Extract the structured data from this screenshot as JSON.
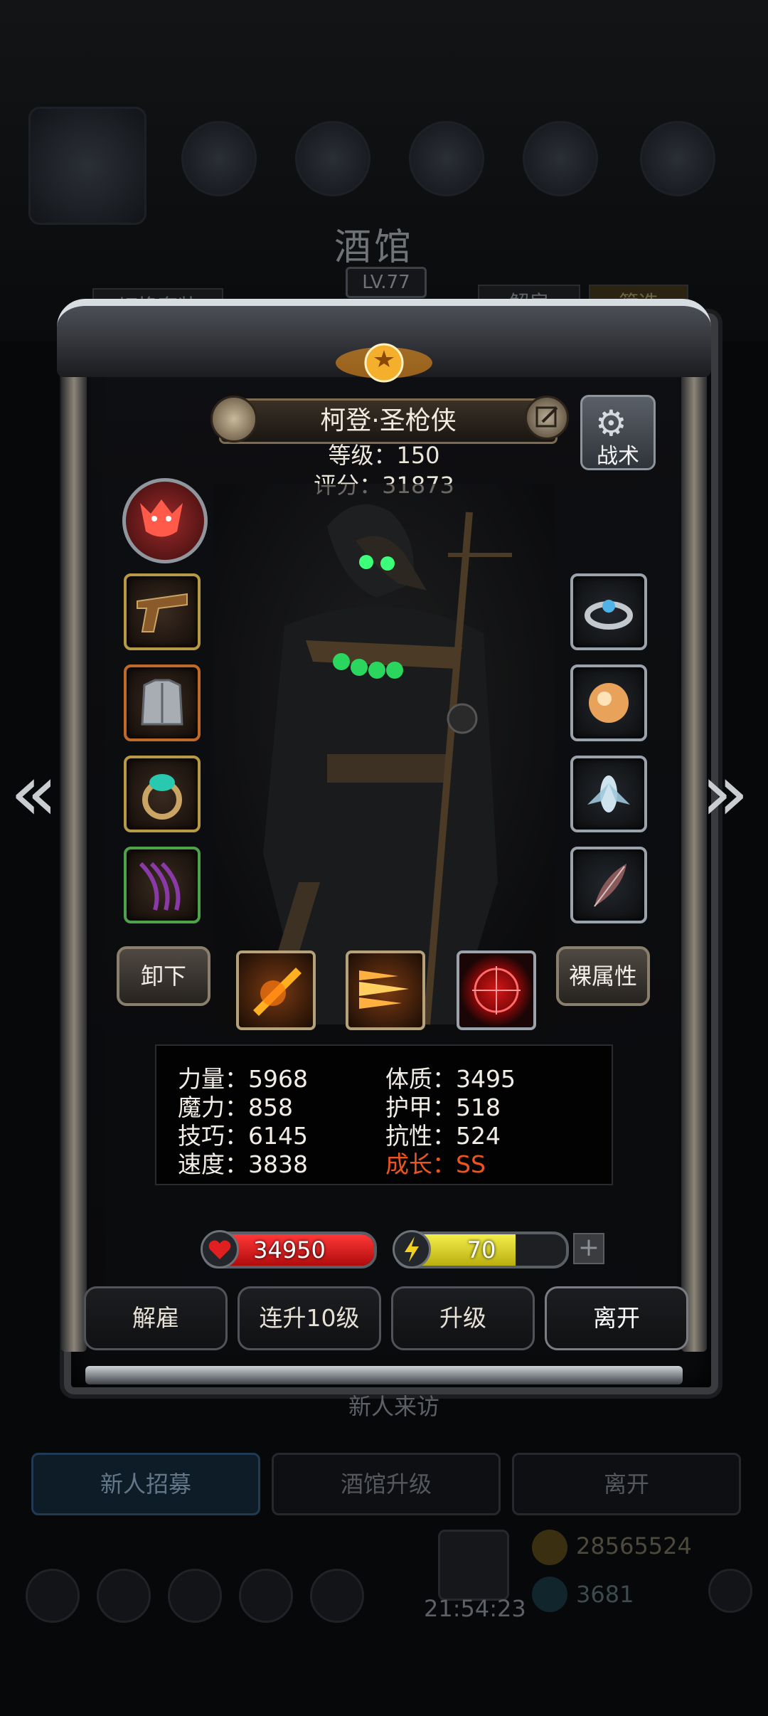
{
  "background": {
    "title": "酒馆",
    "level": "LV.77",
    "switch_outfit": "切换套装",
    "dismiss": "解雇",
    "filter": "筛选",
    "visitor": "新人来访",
    "bottom_buttons": [
      "新人招募",
      "酒馆升级",
      "离开"
    ],
    "gold": "28565524",
    "gems": "3681",
    "clock": "21:54:23"
  },
  "hero": {
    "name": "柯登·圣枪侠",
    "level_line": "等级：150",
    "score_line": "评分：31873",
    "tactics_label": "战术"
  },
  "buttons": {
    "unequip": "卸下",
    "bare_attributes": "裸属性",
    "prev_icon": "chevron-left",
    "next_icon": "chevron-right"
  },
  "equipment_left": [
    "emblem-icon",
    "pistol-icon",
    "armor-icon",
    "ring-icon",
    "whip-icon"
  ],
  "equipment_right": [
    "silver-ring-icon",
    "orb-icon",
    "cicada-icon",
    "feather-icon"
  ],
  "skills": [
    "slash-skill-icon",
    "bullet-skill-icon",
    "target-skill-icon"
  ],
  "stats": {
    "strength": "力量：5968",
    "magic": "魔力：858",
    "skill": "技巧：6145",
    "speed": "速度：3838",
    "constitution": "体质：3495",
    "armor": "护甲：518",
    "resistance": "抗性：524",
    "growth": "成长：SS"
  },
  "hp": {
    "value": "34950",
    "fill_fraction": 1.0,
    "color": "#d81b1b"
  },
  "energy": {
    "value": "70",
    "fill_fraction": 0.7,
    "color": "#e3dc2a"
  },
  "plus_label": "+",
  "actions": [
    "解雇",
    "连升10级",
    "升级",
    "离开"
  ],
  "colors": {
    "growth": "#f0541e",
    "gold_frame": "#b89a45"
  }
}
